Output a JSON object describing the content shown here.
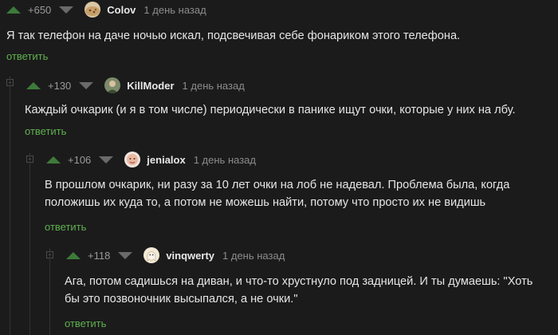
{
  "comments": [
    {
      "rating": "+650",
      "user": "Colov",
      "time": "1 день назад",
      "text": "Я так телефон на даче ночью искал, подсвечивая себе фонариком этого телефона.",
      "reply": "ответить",
      "avatar_icon": "cookie-avatar"
    },
    {
      "rating": "+130",
      "user": "KillModer",
      "time": "1 день назад",
      "text": "Каждый очкарик (и я в том числе) периодически в панике ищут очки, которые у них на лбу.",
      "reply": "ответить",
      "avatar_icon": "person-avatar"
    },
    {
      "rating": "+106",
      "user": "jenialox",
      "time": "1 день назад",
      "text": "В прошлом очкарик, ни разу за 10 лет очки на лоб не надевал. Проблема была, когда положишь их куда то, а потом не можешь найти, потому что просто их не видишь",
      "reply": "ответить",
      "avatar_icon": "face-avatar"
    },
    {
      "rating": "+118",
      "user": "vinqwerty",
      "time": "1 день назад",
      "text": "Ага, потом садишься на диван, и что-то хрустнуло под задницей. И ты думаешь: \"Хоть бы это позвоночник высыпался, а не очки.\"",
      "reply": "ответить",
      "avatar_icon": "ghost-avatar"
    }
  ],
  "colors": {
    "background": "#1b1b1b",
    "upvote": "#3d7a3a",
    "reply_link": "#5fb04f",
    "muted": "#8c8c8c"
  }
}
